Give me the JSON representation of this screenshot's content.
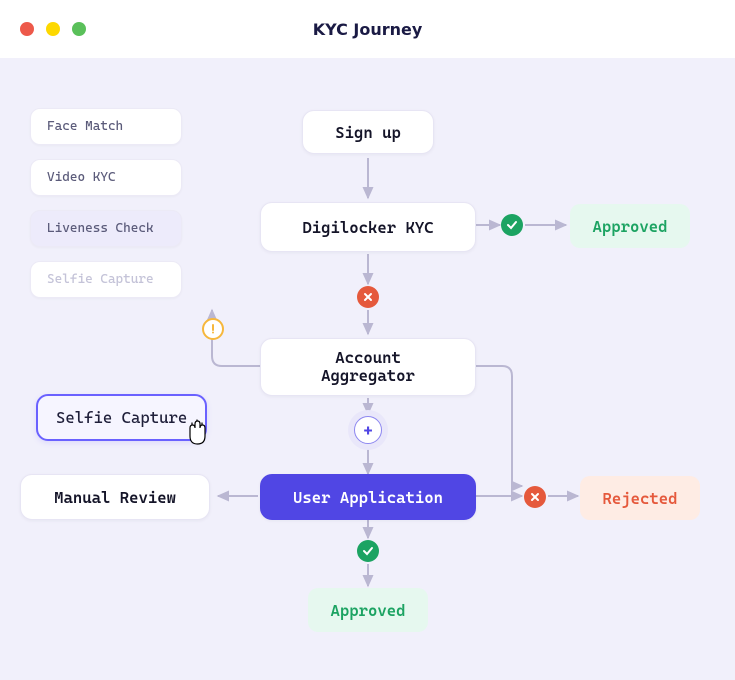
{
  "window": {
    "title": "KYC Journey"
  },
  "palette": {
    "items": [
      {
        "label": "Face Match"
      },
      {
        "label": "Video KYC"
      },
      {
        "label": "Liveness Check"
      },
      {
        "label": "Selfie Capture"
      }
    ]
  },
  "dragged": {
    "label": "Selfie Capture"
  },
  "flow": {
    "signup": "Sign up",
    "digilocker": "Digilocker KYC",
    "account_aggregator": "Account\nAggregator",
    "user_application": "User Application",
    "manual_review": "Manual Review",
    "approved": "Approved",
    "rejected": "Rejected",
    "approved2": "Approved"
  },
  "icons": {
    "plus": "+"
  },
  "colors": {
    "primary": "#5046e4",
    "success": "#1ca362",
    "error": "#e5593c",
    "warn": "#f6b73c",
    "canvas": "#f1f0fb"
  }
}
